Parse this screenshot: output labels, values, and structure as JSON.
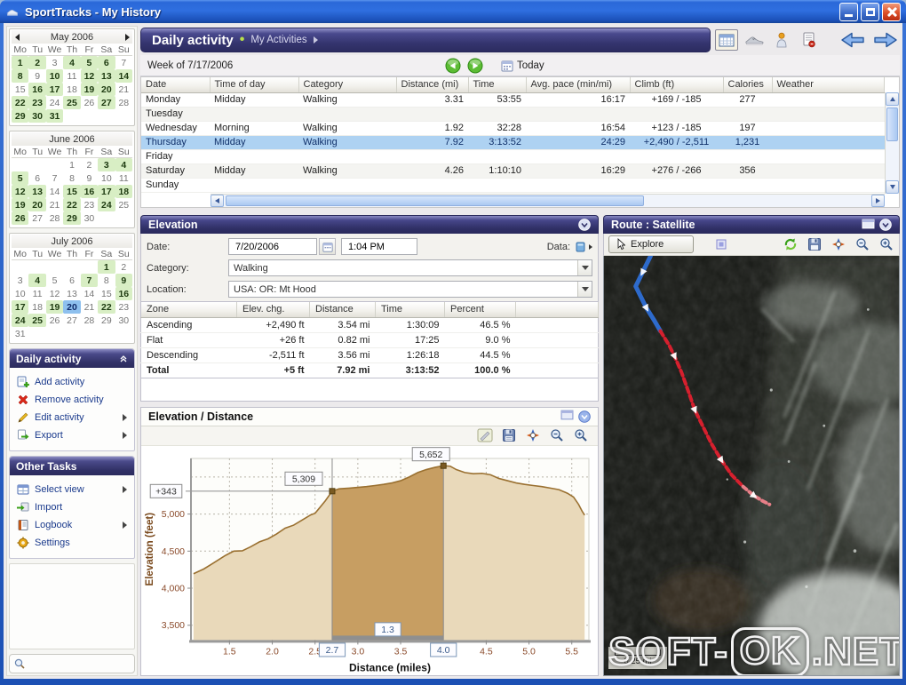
{
  "window": {
    "title": "SportTracks - My History"
  },
  "colors": {
    "titlebar_blue": "#2a68d8",
    "panel_header_purple": "#32326a",
    "selected_row_blue": "#aed2f2",
    "calendar_active_green": "#d8eec4",
    "calendar_selected_blue": "#8ec0ee",
    "chart_area_fill": "#e9d9ba",
    "chart_area_line": "#9a7030",
    "chart_selection_fill": "#c79e62",
    "route_blue": "#2e6fd6",
    "route_red": "#d6202e"
  },
  "sidebar": {
    "weekday_labels": [
      "Mo",
      "Tu",
      "We",
      "Th",
      "Fr",
      "Sa",
      "Su"
    ],
    "calendars": [
      {
        "title": "May 2006",
        "nav": true,
        "start_col": 0,
        "days": 31,
        "active": [
          1,
          2,
          4,
          5,
          6,
          8,
          10,
          12,
          13,
          14,
          16,
          17,
          19,
          20,
          22,
          23,
          25,
          27,
          29,
          30,
          31
        ],
        "selected": null
      },
      {
        "title": "June 2006",
        "nav": false,
        "start_col": 3,
        "days": 30,
        "active": [
          3,
          4,
          5,
          12,
          13,
          15,
          16,
          17,
          18,
          19,
          20,
          22,
          24,
          26,
          29
        ],
        "selected": null
      },
      {
        "title": "July 2006",
        "nav": false,
        "start_col": 5,
        "days": 31,
        "active": [
          1,
          4,
          7,
          9,
          16,
          17,
          19,
          22,
          24,
          25
        ],
        "selected": 20
      }
    ],
    "panels": [
      {
        "title": "Daily activity",
        "collapse": true,
        "items": [
          {
            "label": "Add activity",
            "icon": "add-activity-icon",
            "submenu": false
          },
          {
            "label": "Remove activity",
            "icon": "remove-activity-icon",
            "submenu": false
          },
          {
            "label": "Edit activity",
            "icon": "edit-activity-icon",
            "submenu": true
          },
          {
            "label": "Export",
            "icon": "export-icon",
            "submenu": true
          }
        ]
      },
      {
        "title": "Other Tasks",
        "collapse": false,
        "items": [
          {
            "label": "Select view",
            "icon": "select-view-icon",
            "submenu": true
          },
          {
            "label": "Import",
            "icon": "import-icon",
            "submenu": false
          },
          {
            "label": "Logbook",
            "icon": "logbook-icon",
            "submenu": true
          },
          {
            "label": "Settings",
            "icon": "settings-icon",
            "submenu": false
          }
        ]
      }
    ]
  },
  "main_header": {
    "title": "Daily activity",
    "separator": "•",
    "breadcrumb": "My Activities"
  },
  "week_bar": {
    "label": "Week of 7/17/2006",
    "today": "Today"
  },
  "activity_table": {
    "columns": [
      "Date",
      "Time of day",
      "Category",
      "Distance (mi)",
      "Time",
      "Avg. pace (min/mi)",
      "Climb (ft)",
      "Calories",
      "Weather"
    ],
    "rows": [
      {
        "date": "Monday",
        "time_of_day": "Midday",
        "category": "Walking",
        "distance": "3.31",
        "time": "53:55",
        "pace": "16:17",
        "climb": "+169 / -185",
        "calories": "277",
        "weather": "",
        "selected": false
      },
      {
        "date": "Tuesday",
        "time_of_day": "",
        "category": "",
        "distance": "",
        "time": "",
        "pace": "",
        "climb": "",
        "calories": "",
        "weather": "",
        "selected": false
      },
      {
        "date": "Wednesday",
        "time_of_day": "Morning",
        "category": "Walking",
        "distance": "1.92",
        "time": "32:28",
        "pace": "16:54",
        "climb": "+123 / -185",
        "calories": "197",
        "weather": "",
        "selected": false
      },
      {
        "date": "Thursday",
        "time_of_day": "Midday",
        "category": "Walking",
        "distance": "7.92",
        "time": "3:13:52",
        "pace": "24:29",
        "climb": "+2,490 / -2,511",
        "calories": "1,231",
        "weather": "",
        "selected": true
      },
      {
        "date": "Friday",
        "time_of_day": "",
        "category": "",
        "distance": "",
        "time": "",
        "pace": "",
        "climb": "",
        "calories": "",
        "weather": "",
        "selected": false
      },
      {
        "date": "Saturday",
        "time_of_day": "Midday",
        "category": "Walking",
        "distance": "4.26",
        "time": "1:10:10",
        "pace": "16:29",
        "climb": "+276 / -266",
        "calories": "356",
        "weather": "",
        "selected": false
      },
      {
        "date": "Sunday",
        "time_of_day": "",
        "category": "",
        "distance": "",
        "time": "",
        "pace": "",
        "climb": "",
        "calories": "",
        "weather": "",
        "selected": false
      }
    ]
  },
  "elevation_panel": {
    "title": "Elevation",
    "fields": {
      "date_label": "Date:",
      "date": "7/20/2006",
      "time": "1:04 PM",
      "data_label": "Data:",
      "category_label": "Category:",
      "category": "Walking",
      "location_label": "Location:",
      "location": "USA: OR: Mt Hood"
    },
    "zone_table": {
      "columns": [
        "Zone",
        "Elev. chg.",
        "Distance",
        "Time",
        "Percent"
      ],
      "rows": [
        [
          "Ascending",
          "+2,490 ft",
          "3.54 mi",
          "1:30:09",
          "46.5 %"
        ],
        [
          "Flat",
          "+26 ft",
          "0.82 mi",
          "17:25",
          "9.0 %"
        ],
        [
          "Descending",
          "-2,511 ft",
          "3.56 mi",
          "1:26:18",
          "44.5 %"
        ],
        [
          "Total",
          "+5 ft",
          "7.92 mi",
          "3:13:52",
          "100.0 %"
        ]
      ]
    }
  },
  "chart_panel": {
    "title": "Elevation / Distance"
  },
  "chart_data": {
    "type": "area",
    "title": "Elevation / Distance",
    "xlabel": "Distance (miles)",
    "ylabel": "Elevation (feet)",
    "xlim": [
      1.05,
      5.7
    ],
    "ylim": [
      3300,
      5750
    ],
    "x_ticks": [
      1.5,
      2.0,
      2.5,
      3.0,
      3.5,
      4.5,
      5.0,
      5.5
    ],
    "grid_x": [
      1.5,
      2.0,
      2.5,
      3.0,
      3.5,
      4.0,
      4.5,
      5.0,
      5.5
    ],
    "y_ticks": [
      3500,
      4000,
      4500,
      5000
    ],
    "grid_y": [
      3500,
      4000,
      4500,
      5000,
      5500
    ],
    "points": [
      [
        1.08,
        4195
      ],
      [
        1.2,
        4260
      ],
      [
        1.3,
        4330
      ],
      [
        1.45,
        4440
      ],
      [
        1.55,
        4500
      ],
      [
        1.65,
        4505
      ],
      [
        1.75,
        4560
      ],
      [
        1.85,
        4625
      ],
      [
        1.95,
        4665
      ],
      [
        2.05,
        4730
      ],
      [
        2.15,
        4810
      ],
      [
        2.25,
        4850
      ],
      [
        2.35,
        4920
      ],
      [
        2.45,
        4990
      ],
      [
        2.5,
        5010
      ],
      [
        2.55,
        5080
      ],
      [
        2.62,
        5180
      ],
      [
        2.7,
        5309
      ],
      [
        2.78,
        5340
      ],
      [
        2.9,
        5350
      ],
      [
        3.0,
        5360
      ],
      [
        3.1,
        5370
      ],
      [
        3.2,
        5385
      ],
      [
        3.3,
        5400
      ],
      [
        3.4,
        5420
      ],
      [
        3.5,
        5450
      ],
      [
        3.6,
        5500
      ],
      [
        3.7,
        5560
      ],
      [
        3.8,
        5600
      ],
      [
        3.9,
        5630
      ],
      [
        4.0,
        5652
      ],
      [
        4.08,
        5645
      ],
      [
        4.15,
        5600
      ],
      [
        4.25,
        5560
      ],
      [
        4.35,
        5545
      ],
      [
        4.45,
        5550
      ],
      [
        4.55,
        5530
      ],
      [
        4.65,
        5480
      ],
      [
        4.75,
        5450
      ],
      [
        4.85,
        5420
      ],
      [
        4.95,
        5400
      ],
      [
        5.05,
        5385
      ],
      [
        5.15,
        5370
      ],
      [
        5.25,
        5350
      ],
      [
        5.35,
        5330
      ],
      [
        5.45,
        5280
      ],
      [
        5.52,
        5230
      ],
      [
        5.58,
        5130
      ],
      [
        5.62,
        5040
      ],
      [
        5.65,
        4985
      ]
    ],
    "selection": {
      "start": 2.7,
      "end": 4.0,
      "start_label": "2.7",
      "end_label": "4.0",
      "width_label": "1.3"
    },
    "markers": [
      {
        "x": 2.7,
        "y": 5309,
        "label": "5,309"
      },
      {
        "x": 4.0,
        "y": 5652,
        "label": "5,652"
      }
    ],
    "ref_label": "+343",
    "ref_y": 5309
  },
  "route_panel": {
    "title": "Route : Satellite",
    "explore": "Explore",
    "scale": "0.25 mi",
    "route_blue": [
      [
        53,
        0
      ],
      [
        44,
        18
      ],
      [
        36,
        34
      ],
      [
        48,
        58
      ],
      [
        57,
        72
      ],
      [
        64,
        84
      ]
    ],
    "route_red": [
      [
        64,
        84
      ],
      [
        74,
        100
      ],
      [
        80,
        112
      ],
      [
        88,
        130
      ],
      [
        96,
        152
      ],
      [
        103,
        172
      ],
      [
        112,
        190
      ],
      [
        122,
        210
      ],
      [
        133,
        228
      ],
      [
        145,
        245
      ],
      [
        158,
        258
      ],
      [
        170,
        268
      ],
      [
        180,
        274
      ],
      [
        188,
        278
      ]
    ]
  },
  "watermark": {
    "left": "SOFT-",
    "mid": "OK",
    "right": ".NET"
  }
}
